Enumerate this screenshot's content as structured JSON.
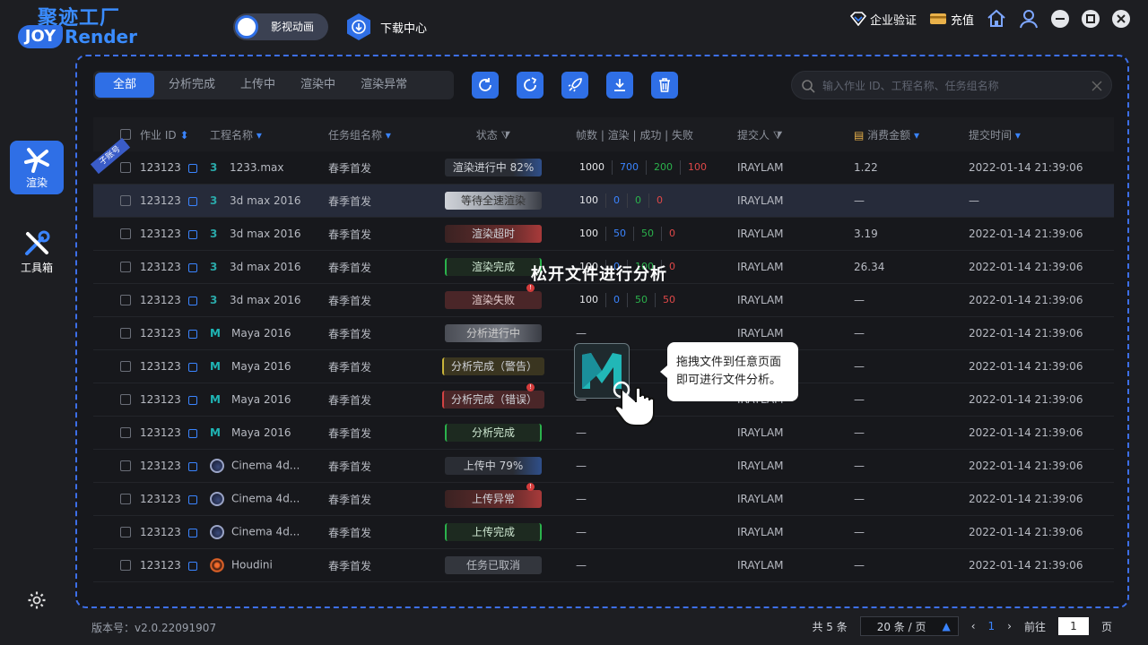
{
  "brand": {
    "cn": "聚迹工厂",
    "badge": "JOY",
    "en": "Render"
  },
  "header": {
    "mode_label": "影视动画",
    "download_center": "下载中心",
    "enterprise_verify": "企业验证",
    "recharge": "充值"
  },
  "sidebar": {
    "items": [
      {
        "label": "渲染"
      },
      {
        "label": "工具箱"
      }
    ]
  },
  "tabs": [
    {
      "label": "全部"
    },
    {
      "label": "分析完成"
    },
    {
      "label": "上传中"
    },
    {
      "label": "渲染中"
    },
    {
      "label": "渲染异常"
    }
  ],
  "search": {
    "placeholder": "输入作业 ID、工程名称、任务组名称"
  },
  "table": {
    "headers": {
      "job_id": "作业 ID",
      "project": "工程名称",
      "group": "任务组名称",
      "status": "状态",
      "counts": "帧数 | 渲染 | 成功 | 失败",
      "submitter": "提交人",
      "cost": "消费金额",
      "time": "提交时间"
    },
    "sub_account_tag": "子账号",
    "rows": [
      {
        "id": "123123",
        "app": "3ds",
        "project": "1233.max",
        "group": "春季首发",
        "status": "渲染进行中 82%",
        "st": "prog",
        "c": [
          "1000",
          "700",
          "200",
          "100"
        ],
        "user": "IRAYLAM",
        "cost": "1.22",
        "time": "2022-01-14 21:39:06"
      },
      {
        "id": "123123",
        "app": "3ds",
        "project": "3d max 2016",
        "group": "春季首发",
        "status": "等待全速渲染",
        "st": "wait",
        "c": [
          "100",
          "0",
          "0",
          "0"
        ],
        "user": "IRAYLAM",
        "cost": "—",
        "time": "—"
      },
      {
        "id": "123123",
        "app": "3ds",
        "project": "3d max 2016",
        "group": "春季首发",
        "status": "渲染超时",
        "st": "warn",
        "c": [
          "100",
          "50",
          "50",
          "0"
        ],
        "user": "IRAYLAM",
        "cost": "3.19",
        "time": "2022-01-14 21:39:06"
      },
      {
        "id": "123123",
        "app": "3ds",
        "project": "3d max 2016",
        "group": "春季首发",
        "status": "渲染完成",
        "st": "ok",
        "c": [
          "100",
          "0",
          "100",
          "0"
        ],
        "user": "IRAYLAM",
        "cost": "26.34",
        "time": "2022-01-14 21:39:06"
      },
      {
        "id": "123123",
        "app": "3ds",
        "project": "3d max 2016",
        "group": "春季首发",
        "status": "渲染失败",
        "st": "fail",
        "c": [
          "100",
          "0",
          "50",
          "50"
        ],
        "user": "IRAYLAM",
        "cost": "—",
        "time": "2022-01-14 21:39:06"
      },
      {
        "id": "123123",
        "app": "maya",
        "project": "Maya 2016",
        "group": "春季首发",
        "status": "分析进行中",
        "st": "ing",
        "c": null,
        "user": "IRAYLAM",
        "cost": "—",
        "time": "2022-01-14 21:39:06"
      },
      {
        "id": "123123",
        "app": "maya",
        "project": "Maya 2016",
        "group": "春季首发",
        "status": "分析完成（警告）",
        "st": "y",
        "c": null,
        "user": "IRAYLAM",
        "cost": "—",
        "time": "2022-01-14 21:39:06"
      },
      {
        "id": "123123",
        "app": "maya",
        "project": "Maya 2016",
        "group": "春季首发",
        "status": "分析完成（错误）",
        "st": "r",
        "c": null,
        "user": "IRAYLAM",
        "cost": "—",
        "time": "2022-01-14 21:39:06"
      },
      {
        "id": "123123",
        "app": "maya",
        "project": "Maya 2016",
        "group": "春季首发",
        "status": "分析完成",
        "st": "ok",
        "c": null,
        "user": "IRAYLAM",
        "cost": "—",
        "time": "2022-01-14 21:39:06"
      },
      {
        "id": "123123",
        "app": "c4d",
        "project": "Cinema 4d...",
        "group": "春季首发",
        "status": "上传中 79%",
        "st": "prog",
        "c": null,
        "user": "IRAYLAM",
        "cost": "—",
        "time": "2022-01-14 21:39:06"
      },
      {
        "id": "123123",
        "app": "c4d",
        "project": "Cinema 4d...",
        "group": "春季首发",
        "status": "上传异常",
        "st": "warn",
        "c": null,
        "user": "IRAYLAM",
        "cost": "—",
        "time": "2022-01-14 21:39:06"
      },
      {
        "id": "123123",
        "app": "c4d",
        "project": "Cinema 4d...",
        "group": "春季首发",
        "status": "上传完成",
        "st": "ok",
        "c": null,
        "user": "IRAYLAM",
        "cost": "—",
        "time": "2022-01-14 21:39:06"
      },
      {
        "id": "123123",
        "app": "houdini",
        "project": "Houdini",
        "group": "春季首发",
        "status": "任务已取消",
        "st": "cancel",
        "c": null,
        "user": "IRAYLAM",
        "cost": "—",
        "time": "2022-01-14 21:39:06"
      }
    ],
    "dash": "—"
  },
  "drop_overlay": {
    "title": "松开文件进行分析",
    "tip_line1": "拖拽文件到任意页面",
    "tip_line2": "即可进行文件分析。"
  },
  "footer": {
    "version": "版本号：v2.0.22091907",
    "total": "共 5 条",
    "page_size": "20 条 / 页",
    "current_page": "1",
    "goto_label": "前往",
    "goto_value": "1",
    "page_suffix": "页"
  }
}
